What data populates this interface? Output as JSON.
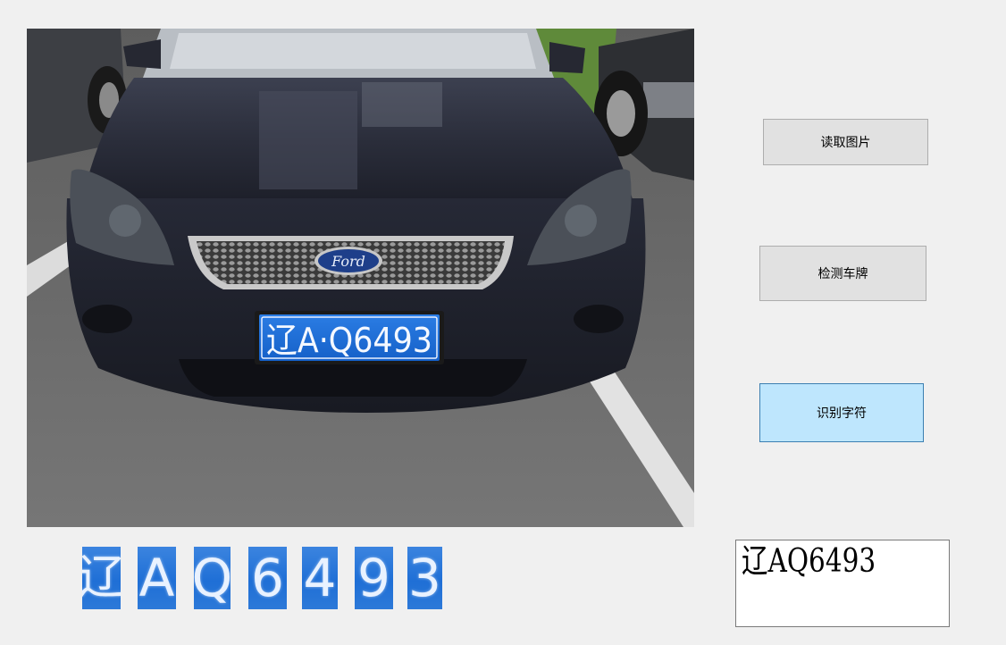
{
  "buttons": {
    "load_image": "读取图片",
    "detect_plate": "检测车牌",
    "recognize_chars": "识别字符"
  },
  "photo": {
    "plate_text": "辽A·Q6493",
    "logo_text": "Ford",
    "colors": {
      "plate": "#1b6cd6",
      "car_body": "#1f2230",
      "asphalt": "#6e6e6e"
    }
  },
  "segmented_chars": [
    "辽",
    "A",
    "Q",
    "6",
    "4",
    "9",
    "3"
  ],
  "result": {
    "text": "辽AQ6493"
  }
}
